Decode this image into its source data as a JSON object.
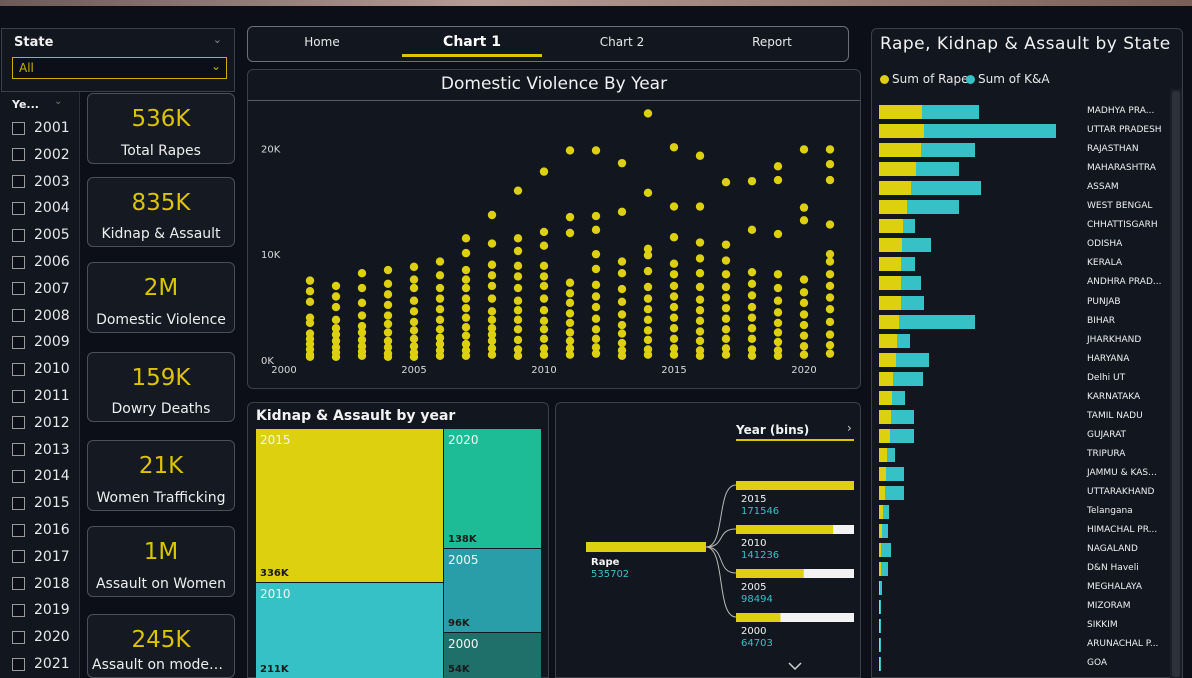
{
  "colors": {
    "yellow": "#dcd00f",
    "teal": "#35c1c6",
    "bg": "#12161f"
  },
  "state_slicer": {
    "label": "State",
    "value": "All"
  },
  "year_slicer": {
    "header": "Ye...",
    "years": [
      "2001",
      "2002",
      "2003",
      "2004",
      "2005",
      "2006",
      "2007",
      "2008",
      "2009",
      "2010",
      "2011",
      "2012",
      "2013",
      "2014",
      "2015",
      "2016",
      "2017",
      "2018",
      "2019",
      "2020",
      "2021"
    ]
  },
  "kpis": [
    {
      "value": "536K",
      "label": "Total Rapes"
    },
    {
      "value": "835K",
      "label": "Kidnap & Assault"
    },
    {
      "value": "2M",
      "label": "Domestic Violence"
    },
    {
      "value": "159K",
      "label": "Dowry Deaths"
    },
    {
      "value": "21K",
      "label": "Women Trafficking"
    },
    {
      "value": "1M",
      "label": "Assault on Women"
    },
    {
      "value": "245K",
      "label": "Assault on modest..."
    }
  ],
  "nav": {
    "items": [
      "Home",
      "Chart 1",
      "Chart 2",
      "Report"
    ],
    "active": "Chart 1"
  },
  "domestic_chart": {
    "title": "Domestic Violence By Year",
    "chart_data": {
      "type": "scatter",
      "title": "Domestic Violence By Year",
      "xlim": [
        2000,
        2021
      ],
      "ylim": [
        0,
        24000
      ],
      "x_ticks": [
        "2000",
        "2005",
        "2010",
        "2015",
        "2020"
      ],
      "y_ticks": [
        "0K",
        "10K",
        "20K"
      ],
      "points_by_year": {
        "2001": [
          7500,
          6500,
          5500,
          4000,
          3500,
          2500,
          2000,
          1500,
          1000,
          500,
          300
        ],
        "2002": [
          7000,
          6000,
          5000,
          3800,
          3000,
          2400,
          1800,
          1200,
          700,
          300
        ],
        "2003": [
          8200,
          6800,
          5400,
          4200,
          3200,
          2600,
          1900,
          1300,
          800,
          400
        ],
        "2004": [
          8500,
          7200,
          6200,
          5200,
          4200,
          3400,
          2600,
          1800,
          1200,
          600,
          300
        ],
        "2005": [
          8800,
          7600,
          6800,
          5600,
          4600,
          3600,
          2800,
          2000,
          1300,
          700,
          300
        ],
        "2006": [
          9300,
          8000,
          6800,
          5800,
          4800,
          3800,
          2900,
          2100,
          1500,
          900,
          400
        ],
        "2007": [
          11500,
          10100,
          8500,
          7600,
          6800,
          5800,
          4900,
          4000,
          3100,
          2300,
          1500,
          900,
          400
        ],
        "2008": [
          13700,
          11000,
          9000,
          8000,
          7000,
          5800,
          4600,
          3800,
          3000,
          2400,
          1800,
          1100,
          500
        ],
        "2009": [
          16000,
          11500,
          10300,
          8900,
          7900,
          6800,
          5600,
          4700,
          3800,
          2900,
          1900,
          1000,
          400
        ],
        "2010": [
          17800,
          12100,
          10800,
          8900,
          7900,
          7000,
          5800,
          4700,
          3700,
          2900,
          2000,
          1100,
          500
        ],
        "2011": [
          19800,
          13500,
          12000,
          7300,
          6300,
          5400,
          4400,
          3500,
          2600,
          1800,
          1100,
          500
        ],
        "2012": [
          19800,
          13600,
          12300,
          10000,
          8600,
          7100,
          6000,
          5000,
          3900,
          2900,
          2000,
          1200,
          600
        ],
        "2013": [
          18600,
          14000,
          9300,
          8200,
          6700,
          5500,
          4300,
          3300,
          2500,
          1600,
          900,
          400
        ],
        "2014": [
          23300,
          15800,
          10500,
          9900,
          8400,
          6900,
          5800,
          4800,
          3800,
          2800,
          1900,
          1000,
          500
        ],
        "2015": [
          20100,
          14500,
          11600,
          9100,
          8100,
          7000,
          6000,
          5000,
          4000,
          3000,
          2000,
          1100,
          500
        ],
        "2016": [
          19300,
          14500,
          11100,
          9600,
          8200,
          6900,
          5700,
          4700,
          3700,
          2700,
          1800,
          900,
          400
        ],
        "2017": [
          16800,
          10900,
          9400,
          8100,
          6900,
          5900,
          4900,
          3900,
          2900,
          2000,
          1100,
          500
        ],
        "2018": [
          16900,
          12300,
          8300,
          7200,
          6100,
          5000,
          4000,
          3000,
          2000,
          1000,
          400
        ],
        "2019": [
          17000,
          18300,
          11900,
          8100,
          6800,
          5600,
          4500,
          3500,
          2600,
          1700,
          900,
          400
        ],
        "2020": [
          19900,
          14400,
          13200,
          7600,
          6400,
          5400,
          4300,
          3300,
          2300,
          1300,
          500
        ],
        "2021": [
          19900,
          18500,
          17000,
          12800,
          10000,
          9300,
          8100,
          7000,
          5900,
          4800,
          3600,
          2400,
          1400,
          600
        ]
      }
    }
  },
  "treemap": {
    "title": "Kidnap & Assault by year",
    "chart_data": {
      "type": "treemap",
      "tiles": [
        {
          "year": "2015",
          "value": "336K",
          "color": "#dcd00f"
        },
        {
          "year": "2020",
          "value": "138K",
          "color": "#1ebc96"
        },
        {
          "year": "2010",
          "value": "211K",
          "color": "#35c1c6"
        },
        {
          "year": "2005",
          "value": "96K",
          "color": "#2a9ea8"
        },
        {
          "year": "2000",
          "value": "54K",
          "color": "#1f6f6a"
        }
      ]
    }
  },
  "decomp_tree": {
    "header": "Year (bins)",
    "root": {
      "label": "Rape",
      "value": "535702"
    },
    "chart_data": {
      "type": "bar",
      "categories": [
        "2015",
        "2010",
        "2005",
        "2000"
      ],
      "values": [
        171546,
        141236,
        98494,
        64703
      ],
      "value_labels": [
        "171546",
        "141236",
        "98494",
        "64703"
      ]
    }
  },
  "state_chart": {
    "title": "Rape, Kidnap & Assault by State",
    "legend": [
      "Sum of Rape",
      "Sum of K&A"
    ],
    "chart_data": {
      "type": "bar",
      "orientation": "horizontal-stacked",
      "series": [
        {
          "name": "Sum of Rape",
          "color": "#dcd00f"
        },
        {
          "name": "Sum of K&A",
          "color": "#35c1c6"
        }
      ],
      "categories": [
        "MADHYA PRA...",
        "UTTAR PRADESH",
        "RAJASTHAN",
        "MAHARASHTRA",
        "ASSAM",
        "WEST BENGAL",
        "CHHATTISGARH",
        "ODISHA",
        "KERALA",
        "ANDHRA PRAD...",
        "PUNJAB",
        "BIHAR",
        "JHARKHAND",
        "HARYANA",
        "Delhi UT",
        "KARNATAKA",
        "TAMIL NADU",
        "GUJARAT",
        "TRIPURA",
        "JAMMU & KAS...",
        "UTTARAKHAND",
        "Telangana",
        "HIMACHAL PR...",
        "NAGALAND",
        "D&N Haveli",
        "MEGHALAYA",
        "MIZORAM",
        "SIKKIM",
        "ARUNACHAL P...",
        "GOA"
      ],
      "rape": [
        43,
        45,
        42,
        37,
        32,
        28,
        24,
        23,
        22,
        22,
        22,
        20,
        18,
        17,
        14,
        13,
        12,
        11,
        8,
        7,
        6,
        4,
        3,
        2,
        2,
        1,
        1,
        1,
        1,
        1
      ],
      "ka": [
        57,
        132,
        54,
        43,
        70,
        52,
        12,
        29,
        14,
        20,
        23,
        76,
        13,
        33,
        30,
        13,
        23,
        24,
        8,
        18,
        19,
        6,
        6,
        10,
        7,
        2,
        1,
        1,
        1,
        1
      ]
    }
  }
}
